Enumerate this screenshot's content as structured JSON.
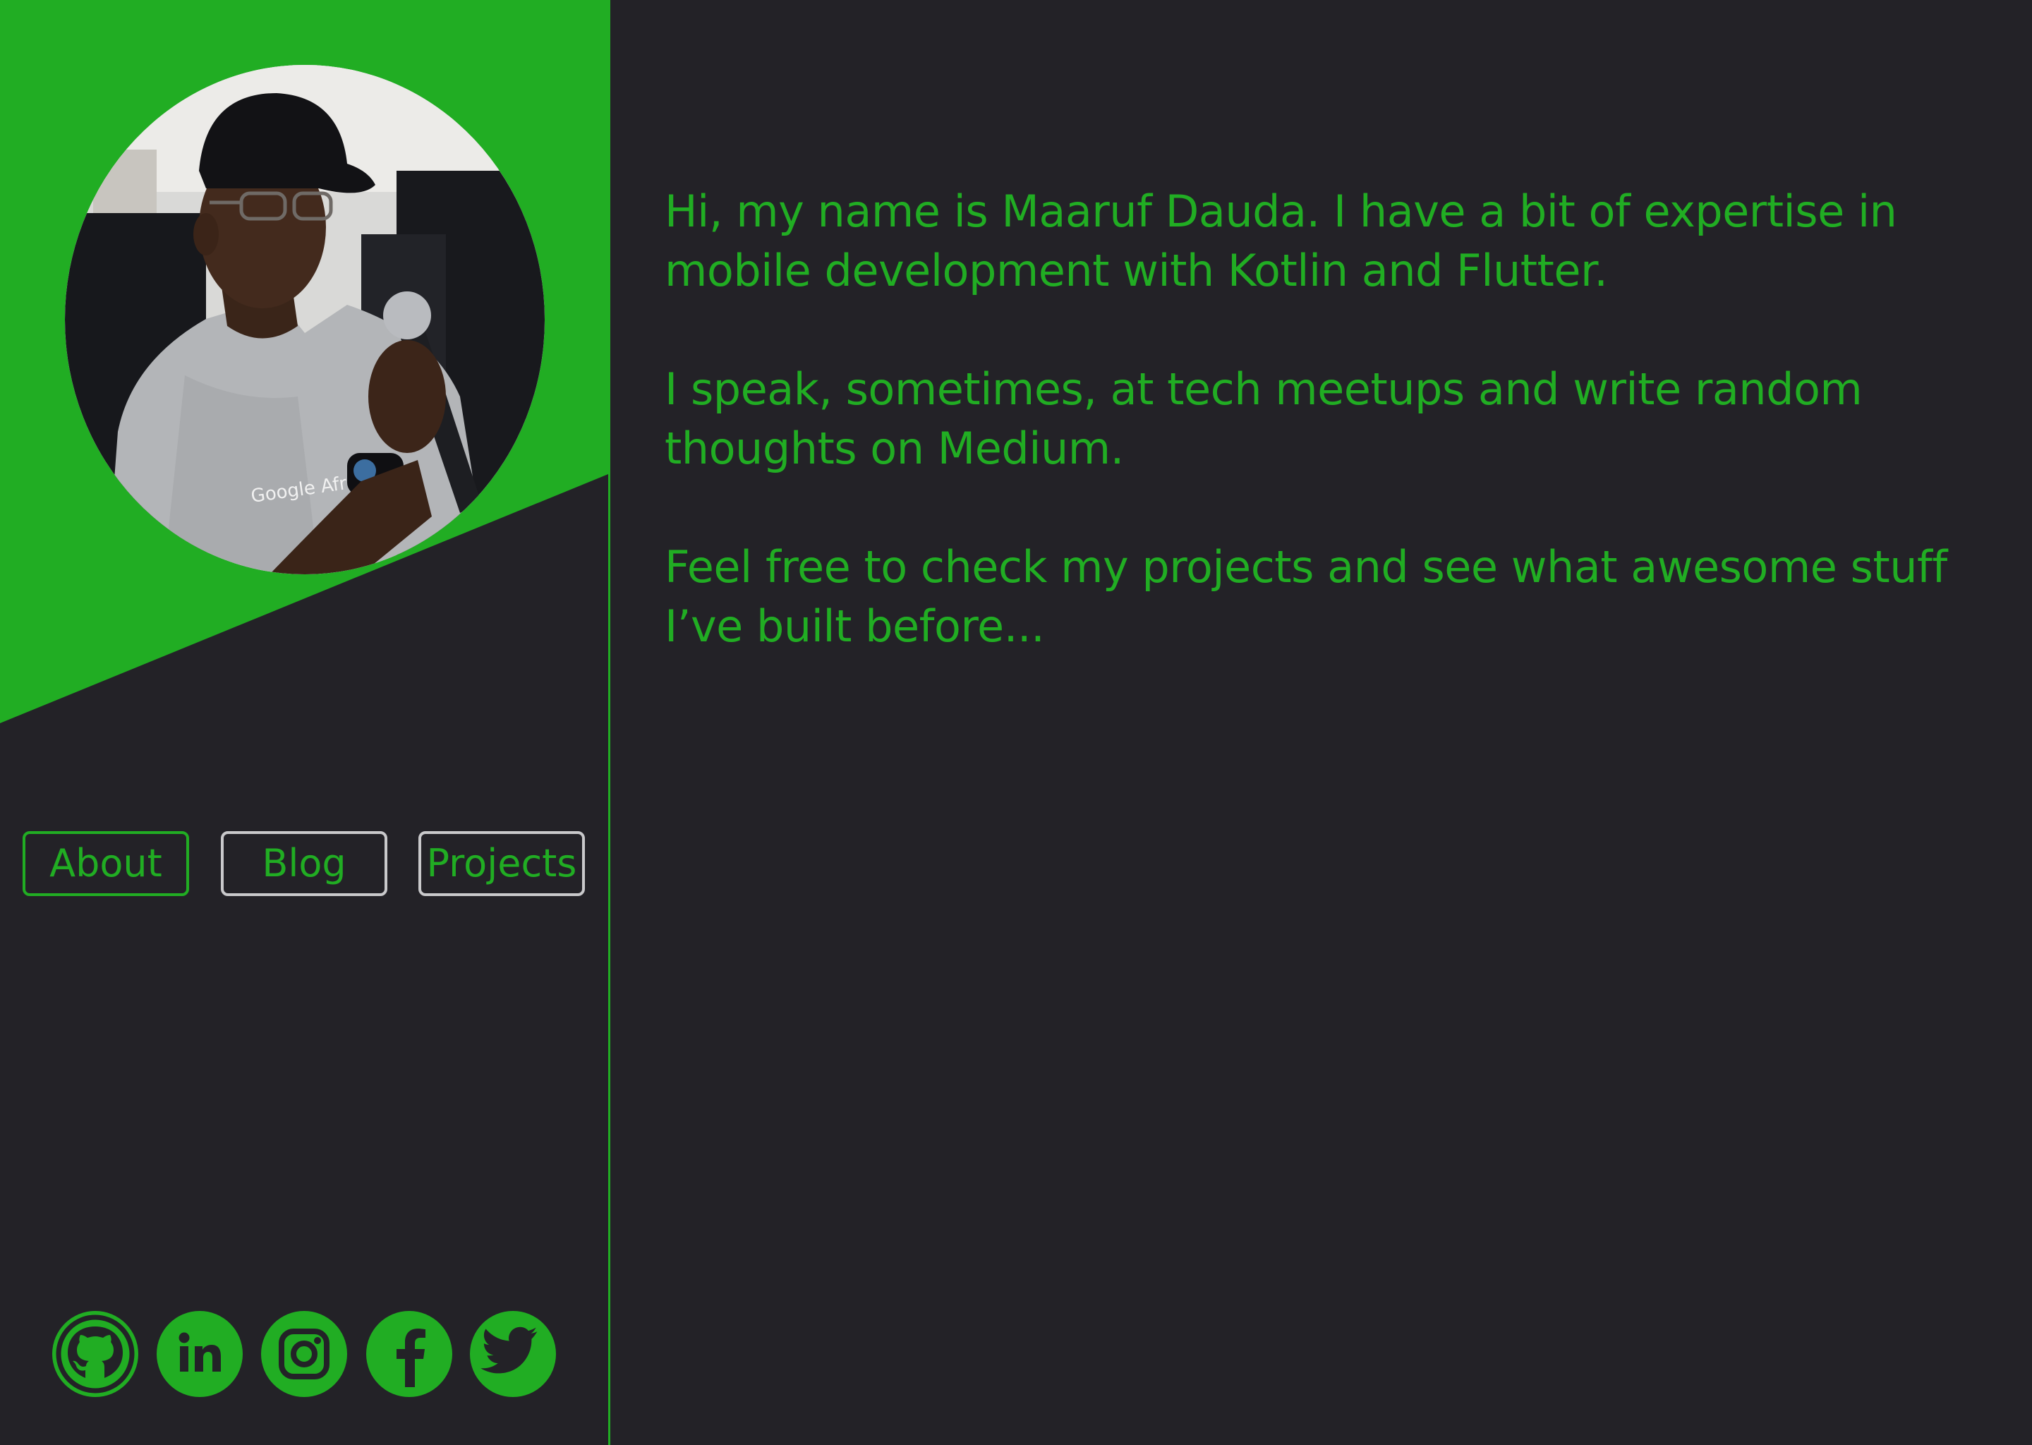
{
  "colors": {
    "accent": "#21ad23",
    "background": "#232227",
    "inactive_border": "#c9c9cb"
  },
  "sidebar": {
    "avatar": {
      "icon": "profile-photo",
      "shirt_text": "Google Afri"
    },
    "nav": [
      {
        "label": "About",
        "active": true
      },
      {
        "label": "Blog",
        "active": false
      },
      {
        "label": "Projects",
        "active": false
      }
    ],
    "socials": [
      {
        "icon": "github-icon"
      },
      {
        "icon": "linkedin-icon"
      },
      {
        "icon": "instagram-icon"
      },
      {
        "icon": "facebook-icon"
      },
      {
        "icon": "twitter-icon"
      }
    ]
  },
  "main": {
    "paragraphs": [
      "Hi, my name is Maaruf Dauda. I have a bit of expertise in mobile development with Kotlin and Flutter.",
      "I speak, sometimes, at tech meetups and write random thoughts on Medium.",
      "Feel free to check my projects and see what awesome stuff I’ve built before..."
    ]
  }
}
